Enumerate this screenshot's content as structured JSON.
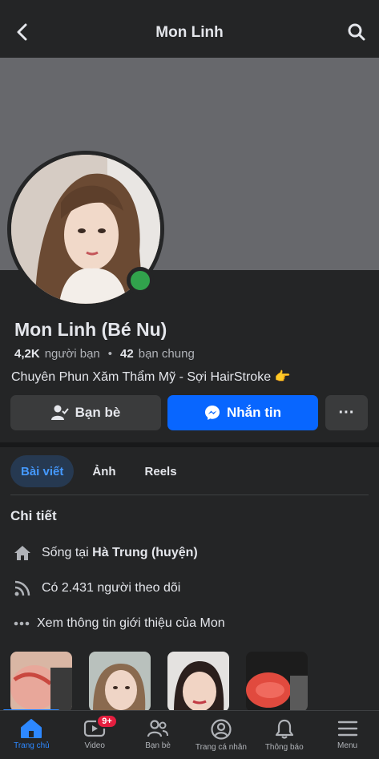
{
  "header": {
    "title": "Mon Linh",
    "back_icon": "chevron-left-icon",
    "search_icon": "search-icon"
  },
  "profile": {
    "name": "Mon Linh (Bé Nu)",
    "friends_count": "4,2K",
    "friends_label": "người bạn",
    "separator": "•",
    "mutual_count": "42",
    "mutual_label": "bạn chung",
    "bio": "Chuyên Phun Xăm Thẩm Mỹ - Sợi HairStroke 👉",
    "online_color": "#31a24c"
  },
  "actions": {
    "friends_label": "Bạn bè",
    "message_label": "Nhắn tin",
    "more_label": "···"
  },
  "tabs": [
    {
      "label": "Bài viết",
      "active": true
    },
    {
      "label": "Ảnh",
      "active": false
    },
    {
      "label": "Reels",
      "active": false
    }
  ],
  "details": {
    "title": "Chi tiết",
    "lives_prefix": "Sống tại ",
    "lives_place": "Hà Trung (huyện)",
    "followers": "Có 2.431 người theo dõi",
    "about": "Xem thông tin giới thiệu của Mon"
  },
  "nav": [
    {
      "label": "Trang chủ",
      "icon": "home-icon",
      "active": true
    },
    {
      "label": "Video",
      "icon": "video-icon",
      "badge": "9+"
    },
    {
      "label": "Bạn bè",
      "icon": "friends-icon"
    },
    {
      "label": "Trang cá nhân",
      "icon": "profile-icon"
    },
    {
      "label": "Thông báo",
      "icon": "bell-icon"
    },
    {
      "label": "Menu",
      "icon": "menu-icon"
    }
  ],
  "colors": {
    "accent": "#0866ff",
    "background": "#242526",
    "cover": "#67686c"
  }
}
